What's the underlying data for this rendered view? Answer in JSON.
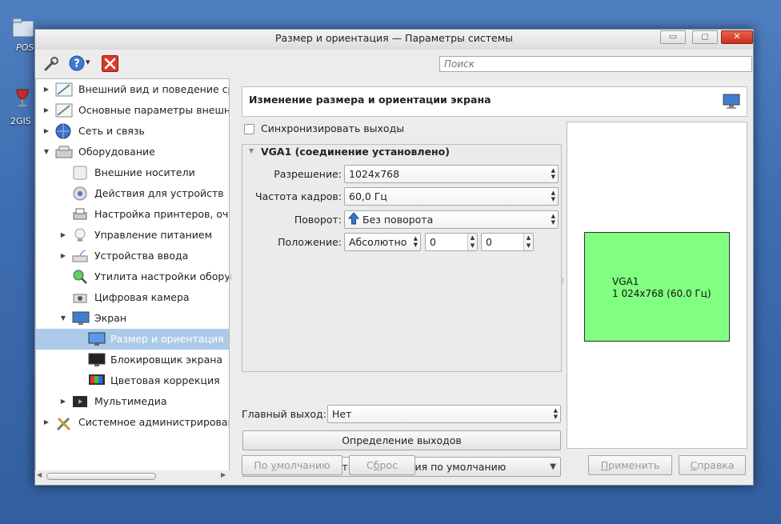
{
  "desktop": {
    "icon1_label": "POS",
    "icon2_label": "2GIS"
  },
  "window": {
    "title": "Размер и ориентация — Параметры системы",
    "controls": {
      "minimize": "▭",
      "maximize": "◻",
      "close": "✕"
    }
  },
  "toolbar": {
    "search_placeholder": "Поиск",
    "help_dropdown": "▾"
  },
  "sidebar": {
    "items": [
      {
        "label": "Внешний вид и поведение сре",
        "arrow": "▶",
        "icon": "appearance-icon"
      },
      {
        "label": "Основные параметры внешне",
        "arrow": "▶",
        "icon": "workspace-icon"
      },
      {
        "label": "Сеть и связь",
        "arrow": "▶",
        "icon": "network-globe-icon"
      },
      {
        "label": "Оборудование",
        "arrow": "▼",
        "icon": "hardware-icon"
      },
      {
        "label": "Внешние носители",
        "arrow": "",
        "icon": "removable-drive-icon"
      },
      {
        "label": "Действия для устройств",
        "arrow": "",
        "icon": "device-actions-icon"
      },
      {
        "label": "Настройка принтеров, очер",
        "arrow": "",
        "icon": "printer-icon"
      },
      {
        "label": "Управление питанием",
        "arrow": "▶",
        "icon": "lightbulb-icon"
      },
      {
        "label": "Устройства ввода",
        "arrow": "▶",
        "icon": "input-devices-icon"
      },
      {
        "label": "Утилита настройки оборудо",
        "arrow": "",
        "icon": "hardware-utility-icon"
      },
      {
        "label": "Цифровая камера",
        "arrow": "",
        "icon": "camera-icon"
      },
      {
        "label": "Экран",
        "arrow": "▼",
        "icon": "monitor-icon"
      },
      {
        "label": "Размер и ориентация",
        "arrow": "",
        "icon": "display-icon"
      },
      {
        "label": "Блокировщик экрана",
        "arrow": "",
        "icon": "screen-locker-icon"
      },
      {
        "label": "Цветовая коррекция",
        "arrow": "",
        "icon": "color-correction-icon"
      },
      {
        "label": "Мультимедиа",
        "arrow": "▶",
        "icon": "multimedia-icon"
      },
      {
        "label": "Системное администрировани",
        "arrow": "▶",
        "icon": "system-admin-icon"
      }
    ]
  },
  "main": {
    "header_title": "Изменение размера и ориентации экрана",
    "sync_outputs_label": "Синхронизировать выходы",
    "sync_outputs_checked": false,
    "output_group_title": "VGA1 (соединение установлено)",
    "resolution_label": "Разрешение:",
    "resolution_value": "1024x768",
    "refresh_label": "Частота кадров:",
    "refresh_value": "60,0 Гц",
    "rotation_label": "Поворот:",
    "rotation_value": "Без поворота",
    "position_label": "Положение:",
    "position_mode": "Абсолютно",
    "position_x": "0",
    "position_y": "0",
    "primary_output_label": "Главный выход:",
    "primary_output_value": "Нет",
    "identify_button": "Определение выходов",
    "save_default_button": "Сохранить как значения по умолчанию",
    "preview_monitor_name": "VGA1",
    "preview_monitor_mode": "1 024x768 (60.0 Гц)",
    "preview_color": "#80ff80"
  },
  "footer": {
    "defaults_prefix": "По ",
    "defaults_underlined": "у",
    "defaults_suffix": "молчанию",
    "reset_prefix": "С",
    "reset_underlined": "б",
    "reset_suffix": "рос",
    "apply_underlined": "П",
    "apply_suffix": "рименить",
    "help_underlined": "С",
    "help_suffix": "правка"
  }
}
